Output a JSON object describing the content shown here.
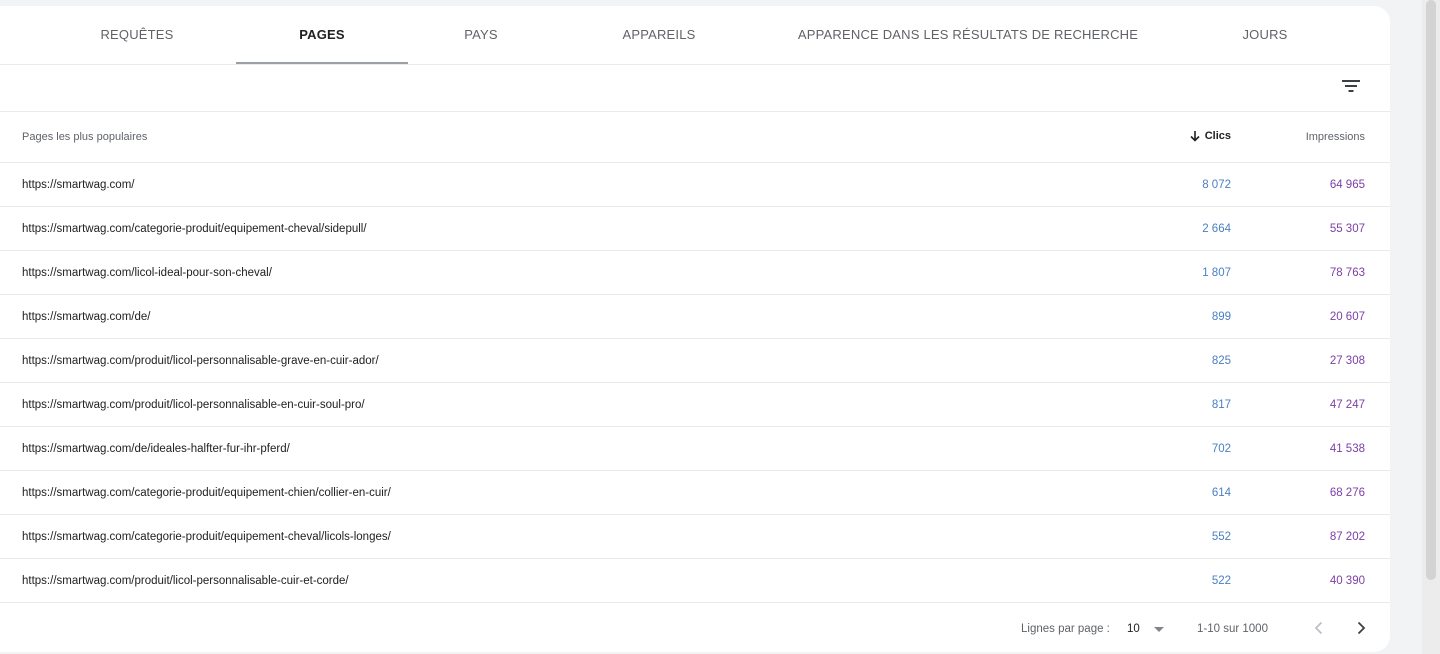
{
  "tabs": [
    {
      "label": "REQUÊTES",
      "active": false
    },
    {
      "label": "PAGES",
      "active": true
    },
    {
      "label": "PAYS",
      "active": false
    },
    {
      "label": "APPAREILS",
      "active": false
    },
    {
      "label": "APPARENCE DANS LES RÉSULTATS DE RECHERCHE",
      "active": false
    },
    {
      "label": "JOURS",
      "active": false
    }
  ],
  "toolbar": {
    "filter_icon": "filter-icon"
  },
  "table": {
    "headers": {
      "page": "Pages les plus populaires",
      "clics": "Clics",
      "impressions": "Impressions"
    },
    "sort": {
      "column": "clics",
      "direction": "descending",
      "icon": "arrow-down-icon"
    },
    "rows": [
      {
        "url": "https://smartwag.com/",
        "clics": "8 072",
        "impressions": "64 965"
      },
      {
        "url": "https://smartwag.com/categorie-produit/equipement-cheval/sidepull/",
        "clics": "2 664",
        "impressions": "55 307"
      },
      {
        "url": "https://smartwag.com/licol-ideal-pour-son-cheval/",
        "clics": "1 807",
        "impressions": "78 763"
      },
      {
        "url": "https://smartwag.com/de/",
        "clics": "899",
        "impressions": "20 607"
      },
      {
        "url": "https://smartwag.com/produit/licol-personnalisable-grave-en-cuir-ador/",
        "clics": "825",
        "impressions": "27 308"
      },
      {
        "url": "https://smartwag.com/produit/licol-personnalisable-en-cuir-soul-pro/",
        "clics": "817",
        "impressions": "47 247"
      },
      {
        "url": "https://smartwag.com/de/ideales-halfter-fur-ihr-pferd/",
        "clics": "702",
        "impressions": "41 538"
      },
      {
        "url": "https://smartwag.com/categorie-produit/equipement-chien/collier-en-cuir/",
        "clics": "614",
        "impressions": "68 276"
      },
      {
        "url": "https://smartwag.com/categorie-produit/equipement-cheval/licols-longes/",
        "clics": "552",
        "impressions": "87 202"
      },
      {
        "url": "https://smartwag.com/produit/licol-personnalisable-cuir-et-corde/",
        "clics": "522",
        "impressions": "40 390"
      }
    ]
  },
  "footer": {
    "rows_per_page_label": "Lignes par page :",
    "rows_per_page_value": "10",
    "range": "1-10 sur 1000",
    "prev_icon": "chevron-left-icon",
    "next_icon": "chevron-right-icon"
  },
  "colors": {
    "clics": "#4a7fc1",
    "impressions": "#7b3fa6",
    "tab_underline": "#9aa0a6"
  }
}
